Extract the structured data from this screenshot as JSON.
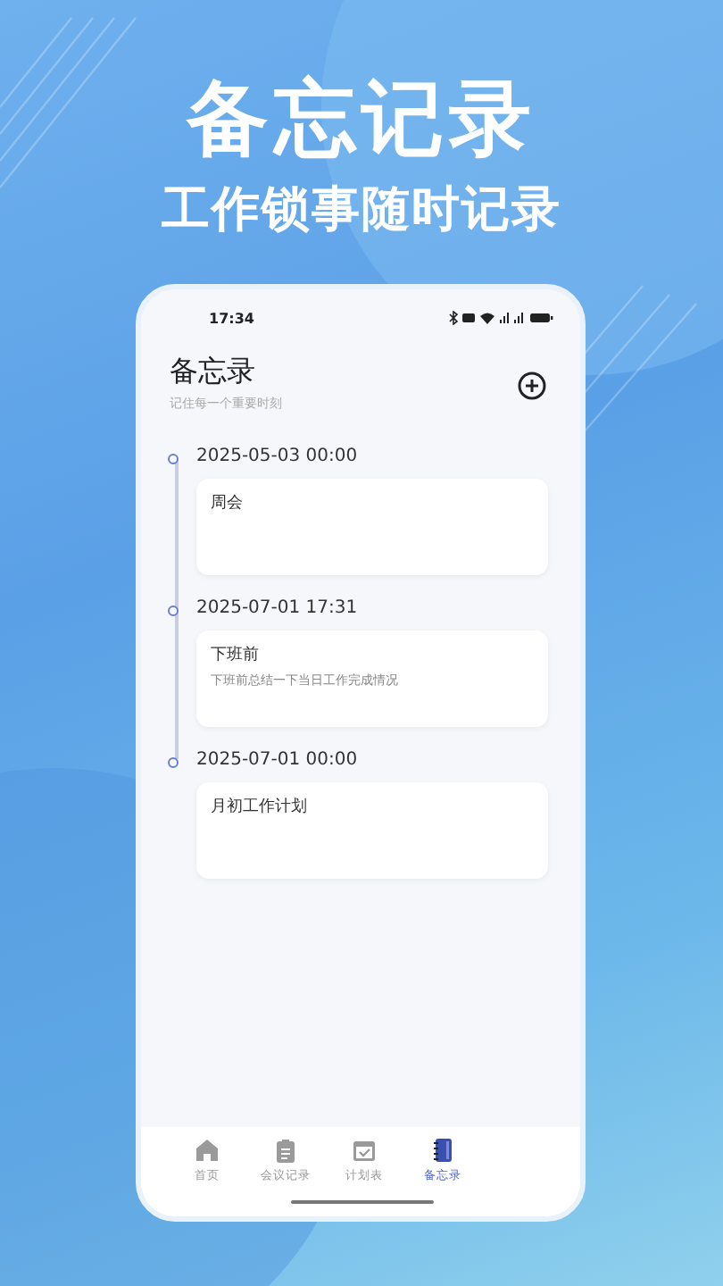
{
  "hero": {
    "title": "备忘记录",
    "subtitle": "工作锁事随时记录"
  },
  "status_bar": {
    "time": "17:34"
  },
  "header": {
    "title": "备忘录",
    "subtitle": "记住每一个重要时刻"
  },
  "entries": [
    {
      "time": "2025-05-03 00:00",
      "title": "周会"
    },
    {
      "time": "2025-07-01 17:31",
      "title": "下班前",
      "body": "下班前总结一下当日工作完成情况"
    },
    {
      "time": "2025-07-01 00:00",
      "title": "月初工作计划"
    }
  ],
  "tabs": [
    {
      "label": "首页",
      "kind": "home",
      "selected": false
    },
    {
      "label": "会议记录",
      "kind": "notes",
      "selected": false
    },
    {
      "label": "计划表",
      "kind": "calendar",
      "selected": false
    },
    {
      "label": "备忘录",
      "kind": "notebook",
      "selected": true
    }
  ]
}
